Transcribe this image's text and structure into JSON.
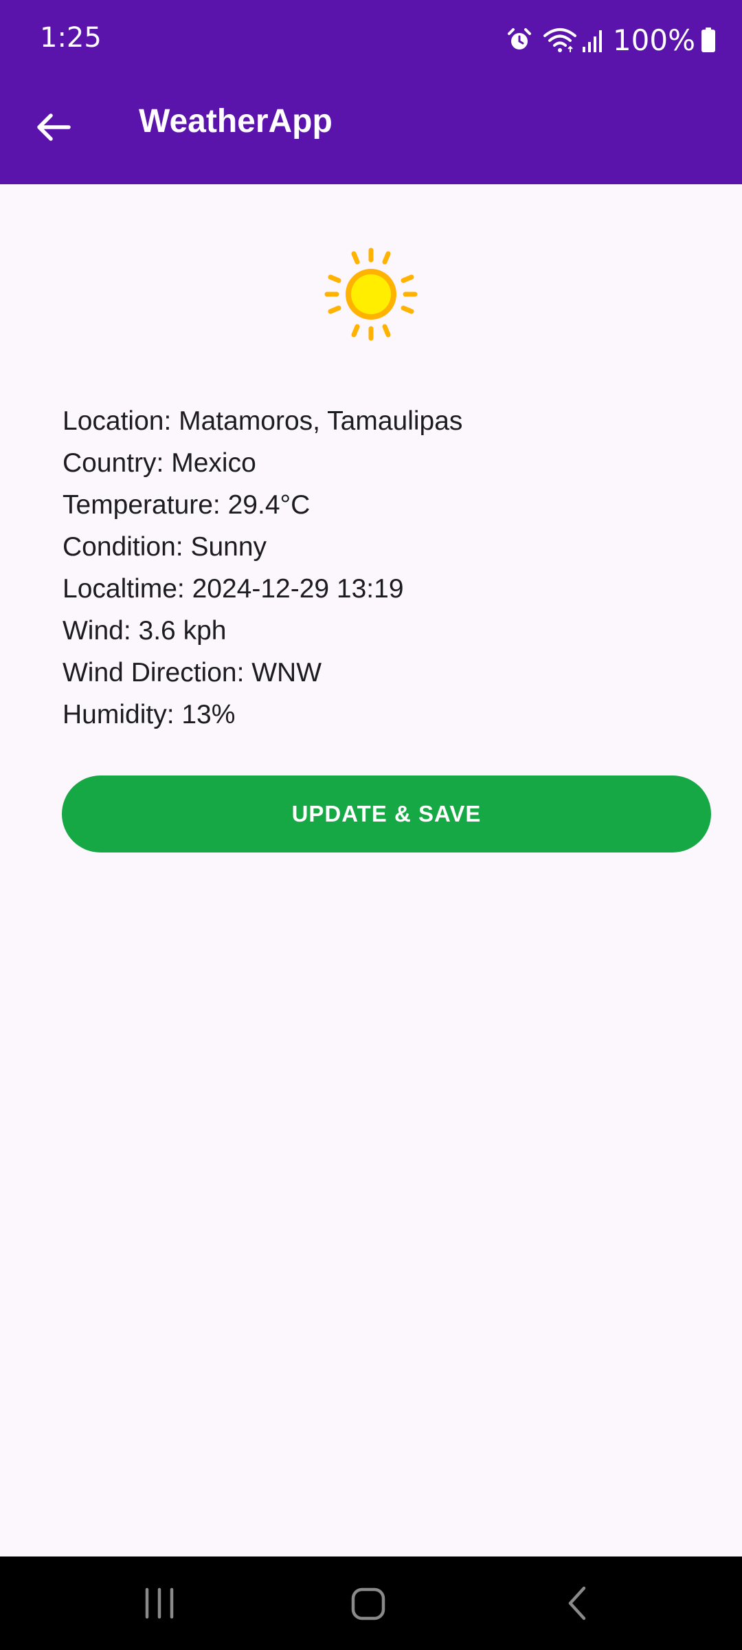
{
  "status_bar": {
    "time": "1:25",
    "battery": "100%",
    "icons": [
      "alarm-icon",
      "wifi-icon",
      "signal-icon",
      "battery-icon"
    ]
  },
  "app_bar": {
    "title": "WeatherApp",
    "back_icon": "arrow-back-icon"
  },
  "weather": {
    "icon": "sun-icon",
    "rows": [
      "Location: Matamoros, Tamaulipas",
      "Country: Mexico",
      "Temperature: 29.4°C",
      "Condition: Sunny",
      "Localtime: 2024-12-29 13:19",
      "Wind: 3.6 kph",
      "Wind Direction: WNW",
      "Humidity: 13%"
    ]
  },
  "actions": {
    "update_label": "UPDATE & SAVE"
  },
  "nav_bar": {
    "icons": [
      "recent-apps-icon",
      "home-icon",
      "back-icon"
    ]
  },
  "colors": {
    "primary": "#5a13ab",
    "button": "#16a844",
    "background": "#fcf6fd"
  }
}
